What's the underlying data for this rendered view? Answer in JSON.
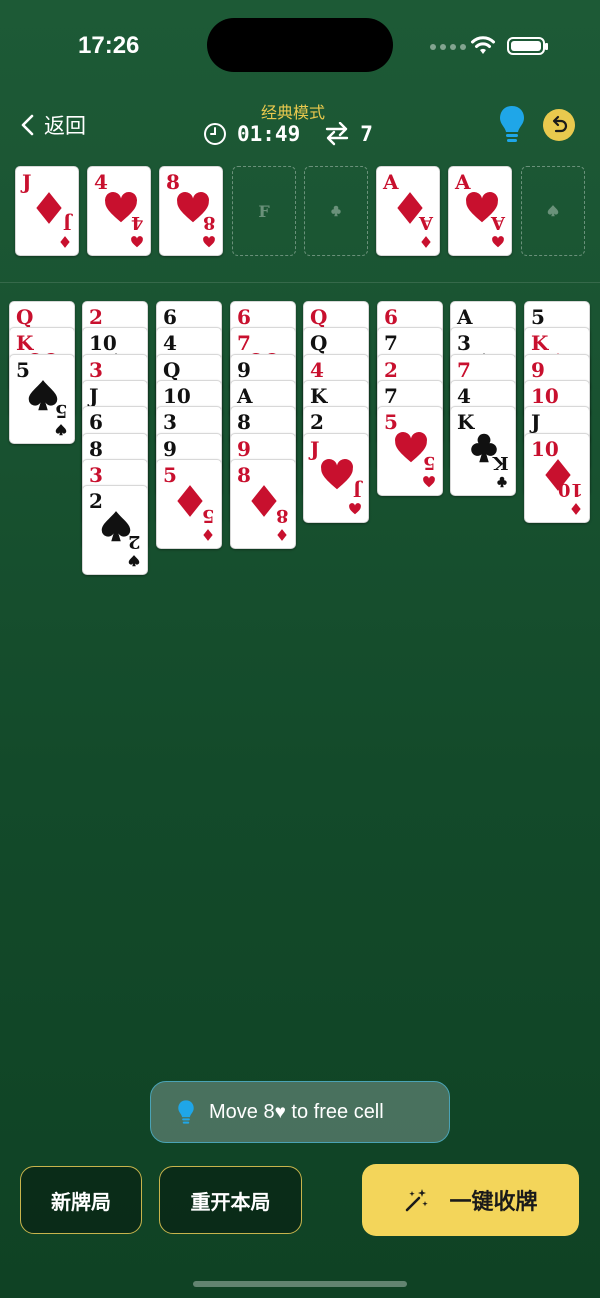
{
  "status": {
    "time": "17:26"
  },
  "header": {
    "back_label": "返回",
    "mode": "经典模式",
    "timer": "01:49",
    "moves": "7",
    "colors": {
      "accent": "#e9c94e",
      "hint_blue": "#1fa6e8"
    }
  },
  "top_row": {
    "free_cells": [
      {
        "rank": "J",
        "suit": "diamonds"
      },
      {
        "rank": "4",
        "suit": "hearts"
      },
      {
        "rank": "8",
        "suit": "hearts"
      },
      {
        "empty_label": "F"
      }
    ],
    "foundations": [
      {
        "empty_suit": "clubs"
      },
      {
        "rank": "A",
        "suit": "diamonds"
      },
      {
        "rank": "A",
        "suit": "hearts"
      },
      {
        "empty_suit": "spades"
      }
    ]
  },
  "tableau": [
    [
      {
        "rank": "Q",
        "suit": "hearts"
      },
      {
        "rank": "K",
        "suit": "hearts"
      },
      {
        "rank": "5",
        "suit": "spades"
      }
    ],
    [
      {
        "rank": "2",
        "suit": "hearts"
      },
      {
        "rank": "10",
        "suit": "spades"
      },
      {
        "rank": "3",
        "suit": "hearts"
      },
      {
        "rank": "J",
        "suit": "spades"
      },
      {
        "rank": "6",
        "suit": "clubs"
      },
      {
        "rank": "8",
        "suit": "spades"
      },
      {
        "rank": "3",
        "suit": "diamonds"
      },
      {
        "rank": "2",
        "suit": "spades"
      }
    ],
    [
      {
        "rank": "6",
        "suit": "spades"
      },
      {
        "rank": "4",
        "suit": "clubs"
      },
      {
        "rank": "Q",
        "suit": "spades"
      },
      {
        "rank": "10",
        "suit": "clubs"
      },
      {
        "rank": "3",
        "suit": "clubs"
      },
      {
        "rank": "9",
        "suit": "spades"
      },
      {
        "rank": "5",
        "suit": "diamonds"
      }
    ],
    [
      {
        "rank": "6",
        "suit": "hearts"
      },
      {
        "rank": "7",
        "suit": "hearts"
      },
      {
        "rank": "9",
        "suit": "clubs"
      },
      {
        "rank": "A",
        "suit": "spades"
      },
      {
        "rank": "8",
        "suit": "clubs"
      },
      {
        "rank": "9",
        "suit": "diamonds"
      },
      {
        "rank": "8",
        "suit": "diamonds"
      }
    ],
    [
      {
        "rank": "Q",
        "suit": "diamonds"
      },
      {
        "rank": "Q",
        "suit": "clubs"
      },
      {
        "rank": "4",
        "suit": "diamonds"
      },
      {
        "rank": "K",
        "suit": "spades"
      },
      {
        "rank": "2",
        "suit": "clubs"
      },
      {
        "rank": "J",
        "suit": "hearts"
      }
    ],
    [
      {
        "rank": "6",
        "suit": "diamonds"
      },
      {
        "rank": "7",
        "suit": "clubs"
      },
      {
        "rank": "2",
        "suit": "diamonds"
      },
      {
        "rank": "7",
        "suit": "spades"
      },
      {
        "rank": "5",
        "suit": "hearts"
      }
    ],
    [
      {
        "rank": "A",
        "suit": "clubs"
      },
      {
        "rank": "3",
        "suit": "spades"
      },
      {
        "rank": "7",
        "suit": "diamonds"
      },
      {
        "rank": "4",
        "suit": "spades"
      },
      {
        "rank": "K",
        "suit": "clubs"
      }
    ],
    [
      {
        "rank": "5",
        "suit": "clubs"
      },
      {
        "rank": "K",
        "suit": "diamonds"
      },
      {
        "rank": "9",
        "suit": "hearts"
      },
      {
        "rank": "10",
        "suit": "hearts"
      },
      {
        "rank": "J",
        "suit": "clubs"
      },
      {
        "rank": "10",
        "suit": "diamonds"
      }
    ]
  ],
  "hint": {
    "prefix": "Move 8",
    "suffix": " to free cell"
  },
  "buttons": {
    "new_game": "新牌局",
    "restart": "重开本局",
    "auto_collect": "一键收牌"
  }
}
